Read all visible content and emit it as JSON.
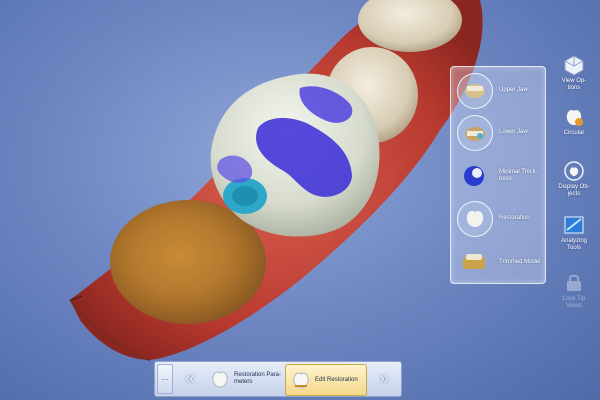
{
  "flyout": {
    "items": [
      {
        "label": "Upper Jaw",
        "icon": "upper-jaw-icon"
      },
      {
        "label": "Lower Jaw",
        "icon": "lower-jaw-icon"
      },
      {
        "label": "Minimal Thick-ness",
        "icon": "minimal-thickness-icon"
      },
      {
        "label": "Restoration",
        "icon": "restoration-icon"
      },
      {
        "label": "Trimmed Model",
        "icon": "trimmed-model-icon"
      }
    ]
  },
  "toolbar": {
    "items": [
      {
        "label": "View Op-tions",
        "icon": "view-options-icon",
        "enabled": true
      },
      {
        "label": "Circular",
        "icon": "circular-icon",
        "enabled": true
      },
      {
        "label": "Display Ob-jects",
        "icon": "display-objects-icon",
        "enabled": true
      },
      {
        "label": "Analyzing Tools",
        "icon": "analyzing-tools-icon",
        "enabled": true
      },
      {
        "label": "Lock Tip Views",
        "icon": "lock-icon",
        "enabled": false
      }
    ]
  },
  "stepbar": {
    "dots": "...",
    "prev": "«",
    "next": "»",
    "steps": [
      {
        "label": "Restoration Para-meters",
        "active": false
      },
      {
        "label": "Edit Restoration",
        "active": true
      }
    ]
  },
  "colors": {
    "background": "#6f88c4",
    "thickness_map": "#3a2ad8",
    "gingiva": "#c8443a",
    "crown": "#dfe3d8"
  }
}
